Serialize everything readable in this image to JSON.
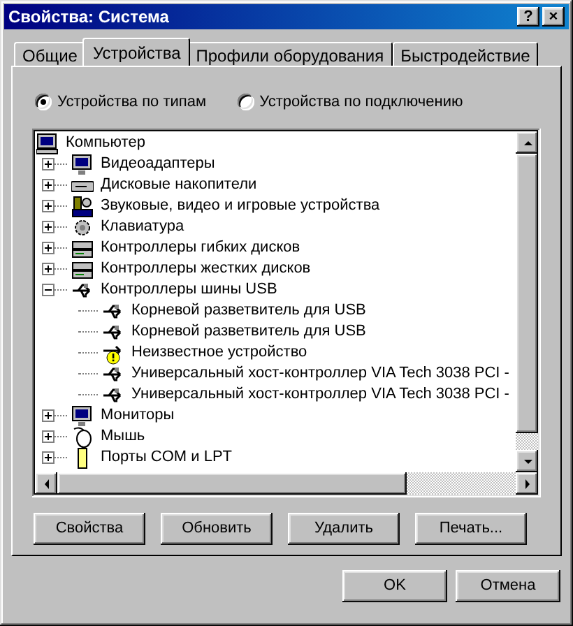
{
  "window": {
    "title": "Свойства: Система",
    "title_buttons": [
      "?",
      "×"
    ]
  },
  "tabs": [
    {
      "label": "Общие",
      "selected": false
    },
    {
      "label": "Устройства",
      "selected": true
    },
    {
      "label": "Профили оборудования",
      "selected": false
    },
    {
      "label": "Быстродействие",
      "selected": false
    }
  ],
  "view_options": [
    {
      "label": "Устройства по типам",
      "selected": true
    },
    {
      "label": "Устройства по подключению",
      "selected": false
    }
  ],
  "tree": {
    "label": "Компьютер",
    "kind": "computer",
    "children": [
      {
        "label": "Видеоадаптеры",
        "kind": "display",
        "expanded": false
      },
      {
        "label": "Дисковые накопители",
        "kind": "disk",
        "expanded": false
      },
      {
        "label": "Звуковые, видео и игровые устройства",
        "kind": "sound",
        "expanded": false
      },
      {
        "label": "Клавиатура",
        "kind": "keyboard",
        "expanded": false
      },
      {
        "label": "Контроллеры гибких дисков",
        "kind": "controller",
        "expanded": false
      },
      {
        "label": "Контроллеры жестких дисков",
        "kind": "controller",
        "expanded": false
      },
      {
        "label": "Контроллеры шины USB",
        "kind": "usb",
        "expanded": true,
        "children": [
          {
            "label": "Корневой разветвитель для USB",
            "kind": "usb"
          },
          {
            "label": "Корневой разветвитель для USB",
            "kind": "usb"
          },
          {
            "label": "Неизвестное устройство",
            "kind": "usb-warning"
          },
          {
            "label": "Универсальный хост-контроллер VIA Tech 3038 PCI -",
            "kind": "usb"
          },
          {
            "label": "Универсальный хост-контроллер VIA Tech 3038 PCI -",
            "kind": "usb"
          }
        ]
      },
      {
        "label": "Мониторы",
        "kind": "display",
        "expanded": false
      },
      {
        "label": "Мышь",
        "kind": "mouse",
        "expanded": false
      },
      {
        "label": "Порты COM и LPT",
        "kind": "port",
        "expanded": false
      }
    ]
  },
  "buttons": [
    "Свойства",
    "Обновить",
    "Удалить",
    "Печать..."
  ],
  "dialog_buttons": [
    "OK",
    "Отмена"
  ]
}
